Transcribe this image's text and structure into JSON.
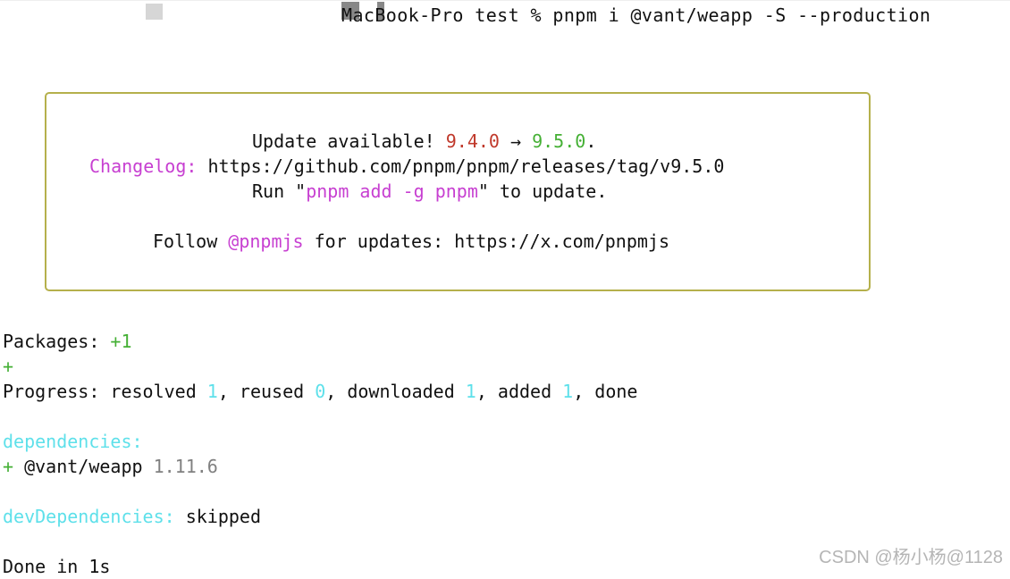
{
  "terminal": {
    "prompt_line": "MacBook-Pro test % pnpm i @vant/weapp -S --production",
    "update_box": {
      "border_color": "#b5b04c",
      "update_prefix": "Update available! ",
      "current_version": "9.4.0",
      "arrow": " → ",
      "new_version": "9.5.0",
      "update_suffix": ".",
      "changelog_label": "Changelog:",
      "changelog_url": " https://github.com/pnpm/pnpm/releases/tag/v9.5.0",
      "run_prefix": "Run \"",
      "run_command": "pnpm add -g pnpm",
      "run_suffix": "\" to update.",
      "follow_prefix": "Follow ",
      "follow_handle": "@pnpmjs",
      "follow_suffix": " for updates: https://x.com/pnpmjs"
    },
    "packages_label": "Packages: ",
    "packages_count": "+1",
    "plus_bar": "+",
    "progress": {
      "label": "Progress: resolved ",
      "resolved": "1",
      "reused_label": ", reused ",
      "reused": "0",
      "downloaded_label": ", downloaded ",
      "downloaded": "1",
      "added_label": ", added ",
      "added": "1",
      "done": ", done"
    },
    "dependencies_label": "dependencies:",
    "dependency": {
      "plus": "+ ",
      "name": "@vant/weapp",
      "version": " 1.11.6"
    },
    "dev_dependencies_label": "devDependencies:",
    "dev_dependencies_value": " skipped",
    "done_line": "Done in 1s"
  },
  "watermark": "CSDN @杨小杨@1128",
  "colors": {
    "red": "#c0392b",
    "green": "#45b035",
    "magenta": "#c73fd1",
    "cyan": "#5ee0ea",
    "gray": "#808080"
  }
}
